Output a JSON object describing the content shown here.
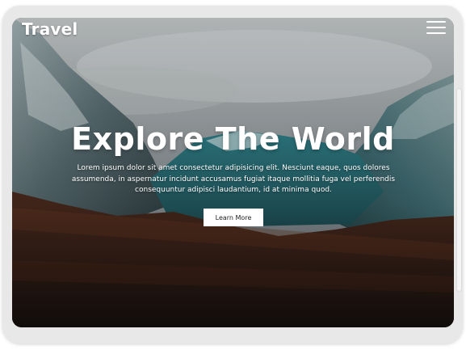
{
  "nav": {
    "brand": "Travel",
    "menu_icon": "hamburger-menu-icon"
  },
  "hero": {
    "title": "Explore The World",
    "description": "Lorem ipsum dolor sit amet consectetur adipisicing elit. Nesciunt eaque, quos dolores assumenda, in aspernatur incidunt accusamus fugiat itaque mollitia fuga vel perferendis consequuntur adipisci laudantium, id at minima quod.",
    "button_label": "Learn More"
  },
  "colors": {
    "text": "#ffffff",
    "button_bg": "#ffffff",
    "button_text": "#222222",
    "device_frame": "#e8e8e8"
  }
}
